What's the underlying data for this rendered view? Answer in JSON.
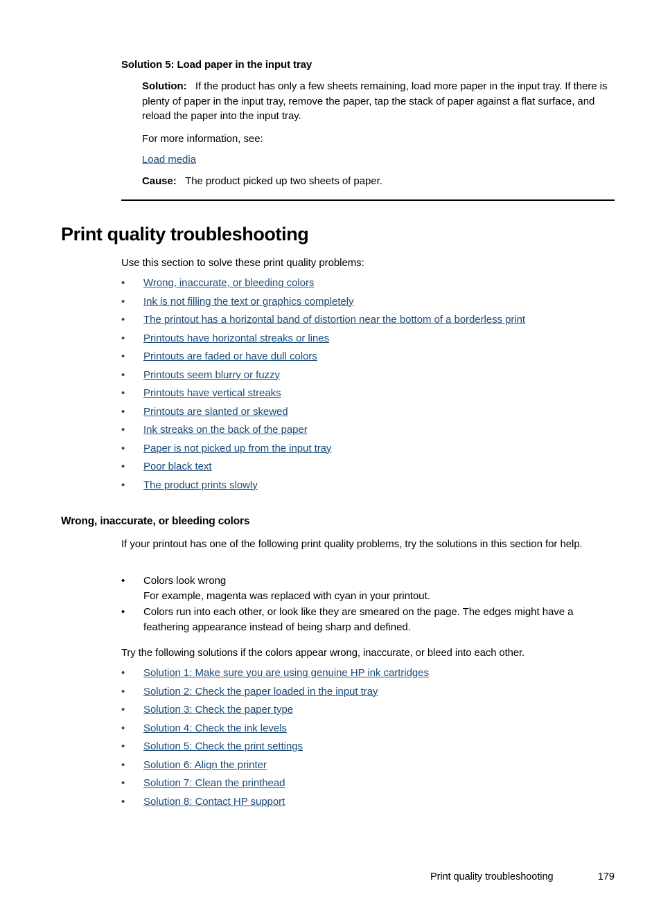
{
  "document": {
    "footer_section": "Print quality troubleshooting",
    "footer_page_number": "179"
  },
  "colors": {
    "link": "#1a4a78",
    "text": "#000000",
    "background": "#ffffff"
  },
  "solution5": {
    "heading": "Solution 5: Load paper in the input tray",
    "solution_label": "Solution:",
    "solution_body": "If the product has only a few sheets remaining, load more paper in the input tray. If there is plenty of paper in the input tray, remove the paper, tap the stack of paper against a flat surface, and reload the paper into the input tray.",
    "more_info": "For more information, see:",
    "link_load_media": "Load media",
    "cause_label": "Cause:",
    "cause_body": "The product picked up two sheets of paper."
  },
  "print_quality": {
    "heading": "Print quality troubleshooting",
    "intro": "Use this section to solve these print quality problems:",
    "problem_links": [
      "Wrong, inaccurate, or bleeding colors",
      "Ink is not filling the text or graphics completely",
      "The printout has a horizontal band of distortion near the bottom of a borderless print",
      "Printouts have horizontal streaks or lines",
      "Printouts are faded or have dull colors",
      "Printouts seem blurry or fuzzy",
      "Printouts have vertical streaks",
      "Printouts are slanted or skewed",
      "Ink streaks on the back of the paper",
      "Paper is not picked up from the input tray",
      "Poor black text",
      "The product prints slowly"
    ]
  },
  "bleeding_colors": {
    "heading": "Wrong, inaccurate, or bleeding colors",
    "intro": "If your printout has one of the following print quality problems, try the solutions in this section for help.",
    "symptoms": [
      {
        "main": "Colors look wrong",
        "sub": "For example, magenta was replaced with cyan in your printout."
      },
      {
        "main": "Colors run into each other, or look like they are smeared on the page. The edges might have a feathering appearance instead of being sharp and defined.",
        "sub": ""
      }
    ],
    "try_line": "Try the following solutions if the colors appear wrong, inaccurate, or bleed into each other.",
    "solution_links": [
      "Solution 1: Make sure you are using genuine HP ink cartridges",
      "Solution 2: Check the paper loaded in the input tray",
      "Solution 3: Check the paper type",
      "Solution 4: Check the ink levels",
      "Solution 5: Check the print settings",
      "Solution 6: Align the printer",
      "Solution 7: Clean the printhead",
      "Solution 8: Contact HP support"
    ]
  }
}
